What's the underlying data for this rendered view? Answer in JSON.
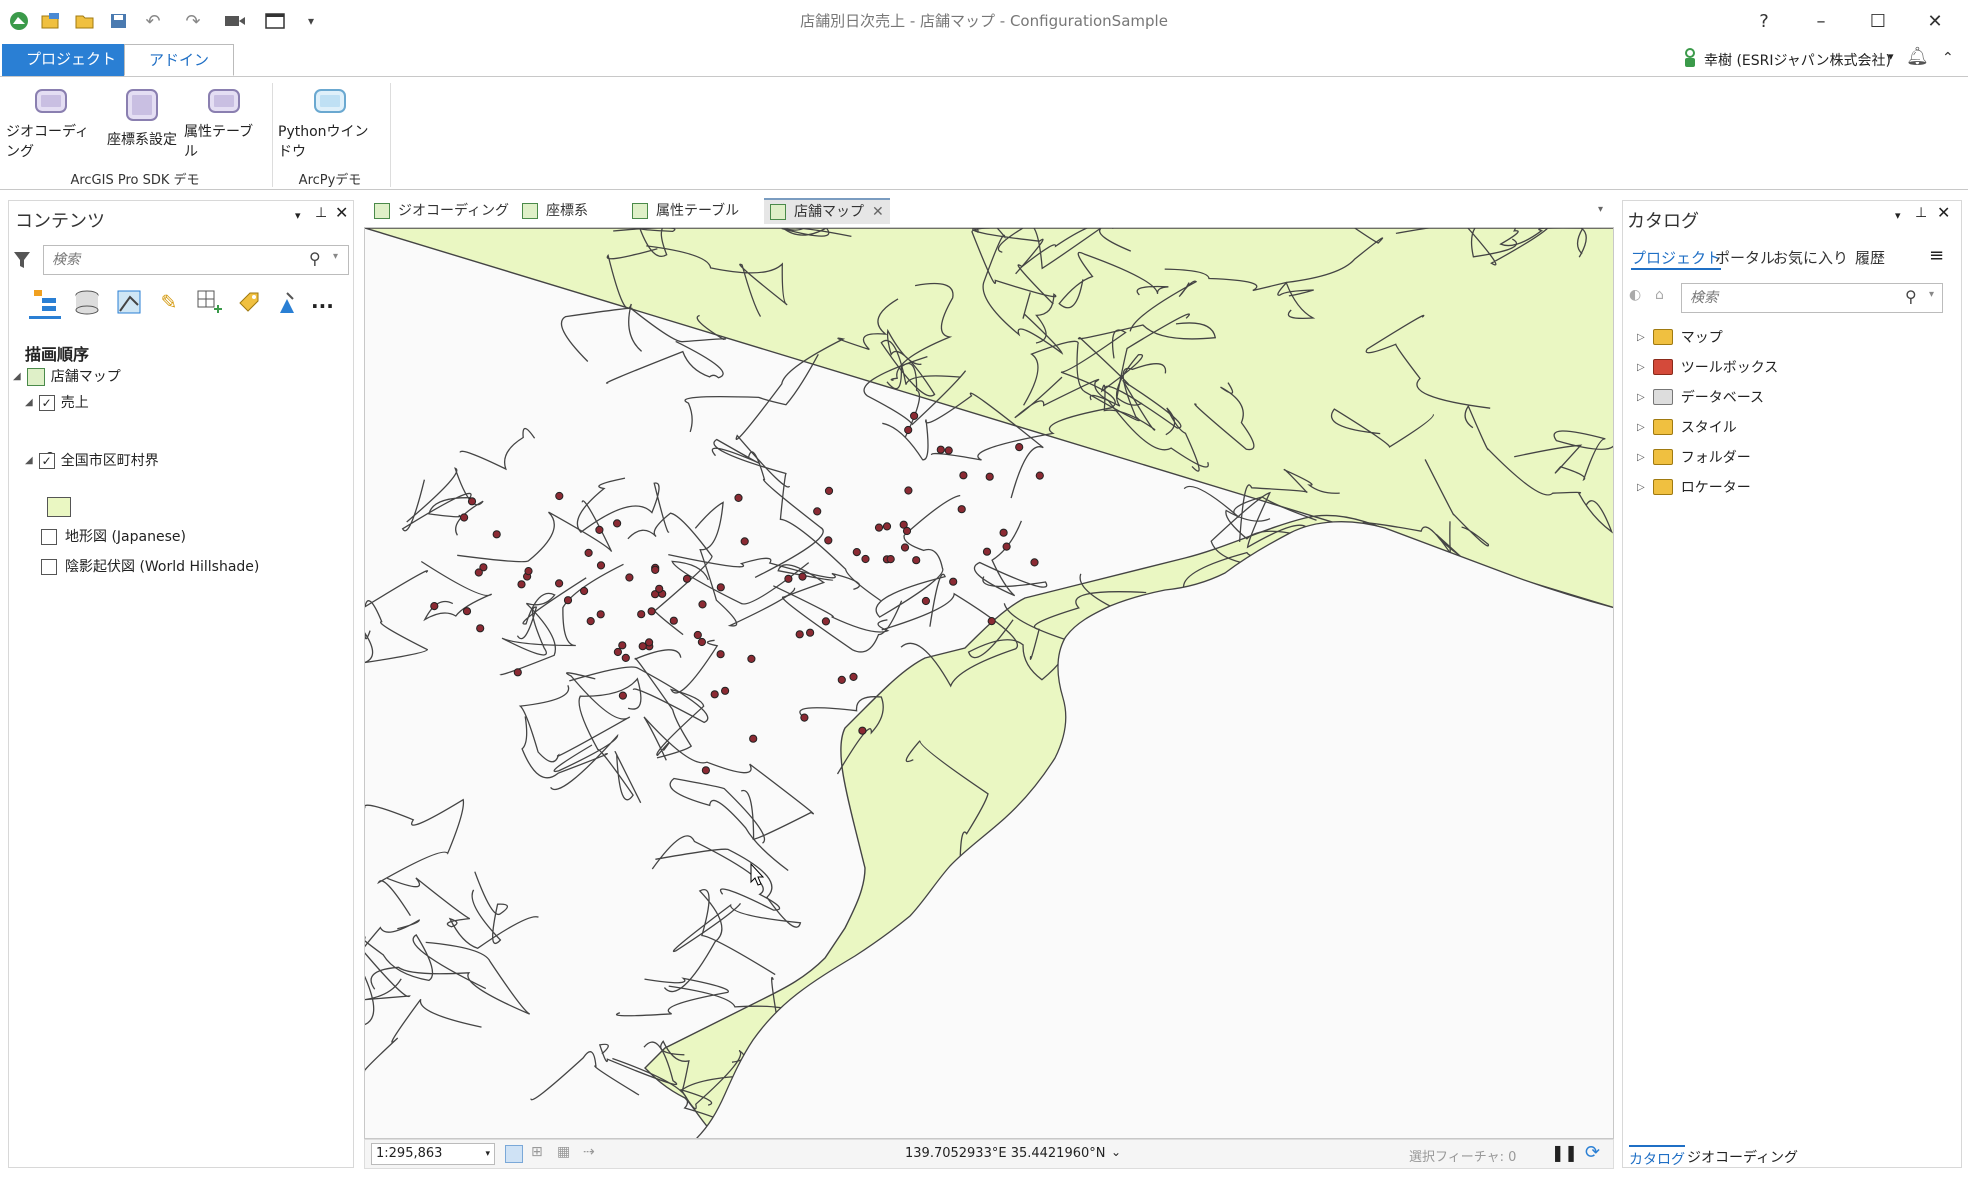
{
  "window": {
    "title": "店舗別日次売上 - 店舗マップ - ConfigurationSample"
  },
  "quick_access": [
    "app-logo-icon",
    "new-project-icon",
    "open-project-icon",
    "save-project-icon",
    "undo-icon",
    "redo-icon",
    "camera-icon",
    "window-icon",
    "customize-dropdown-icon"
  ],
  "window_controls": {
    "help": "?",
    "minimize": "–",
    "maximize": "☐",
    "close": "✕"
  },
  "ribbon_tabs": {
    "project": "プロジェクト",
    "addin": "アドイン"
  },
  "user": {
    "name": "幸樹 (ESRIジャパン株式会社)"
  },
  "ribbon": {
    "groups": [
      {
        "label": "ArcGIS Pro SDK デモ",
        "buttons": [
          "ジオコーディング",
          "座標系設定",
          "属性テーブル"
        ]
      },
      {
        "label": "ArcPyデモ",
        "buttons": [
          "Pythonウインドウ"
        ]
      }
    ]
  },
  "contents": {
    "title": "コンテンツ",
    "search_placeholder": "検索",
    "heading": "描画順序",
    "map_name": "店舗マップ",
    "layers": [
      {
        "name": "売上",
        "checked": true
      },
      {
        "name": "全国市区町村界",
        "checked": true
      },
      {
        "name": "地形図 (Japanese)",
        "checked": false
      },
      {
        "name": "陰影起伏図 (World Hillshade)",
        "checked": false
      }
    ],
    "more": "..."
  },
  "view_tabs": [
    "ジオコーディング",
    "座標系",
    "属性テーブル",
    "店舗マップ"
  ],
  "status": {
    "scale": "1:295,863",
    "coordinates": "139.7052933°E 35.4421960°N",
    "selected_features": "選択フィーチャ: 0"
  },
  "catalog": {
    "title": "カタログ",
    "tabs": [
      "プロジェクト",
      "ポータル",
      "お気に入り",
      "履歴"
    ],
    "search_placeholder": "検索",
    "items": [
      "マップ",
      "ツールボックス",
      "データベース",
      "スタイル",
      "フォルダー",
      "ロケーター"
    ],
    "bottom_tabs": [
      "カタログ",
      "ジオコーディング"
    ]
  },
  "colors": {
    "accent": "#2a7fd4",
    "land": "#eaf7c2",
    "water": "#fafafa",
    "point_fill": "#8b2a33",
    "boundary": "#444444"
  }
}
